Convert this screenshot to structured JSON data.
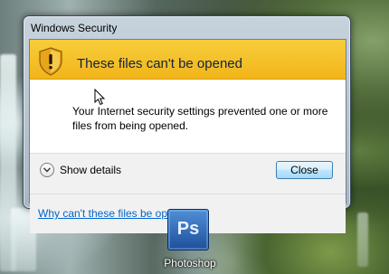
{
  "window": {
    "title": "Windows Security"
  },
  "header": {
    "title": "These files can't be opened",
    "icon": "warning-shield-icon"
  },
  "message": {
    "text": "Your Internet security settings prevented one or more files from being opened."
  },
  "details": {
    "toggle_label": "Show details"
  },
  "buttons": {
    "close_label": "Close"
  },
  "footer": {
    "link_text": "Why can't these files be opened?"
  },
  "desktop": {
    "icon_label": "Photoshop",
    "icon_glyph": "Ps"
  },
  "colors": {
    "header_bg": "#f1b51a",
    "link": "#0066cc",
    "desktop_icon_bg": "#1e4f9b"
  }
}
